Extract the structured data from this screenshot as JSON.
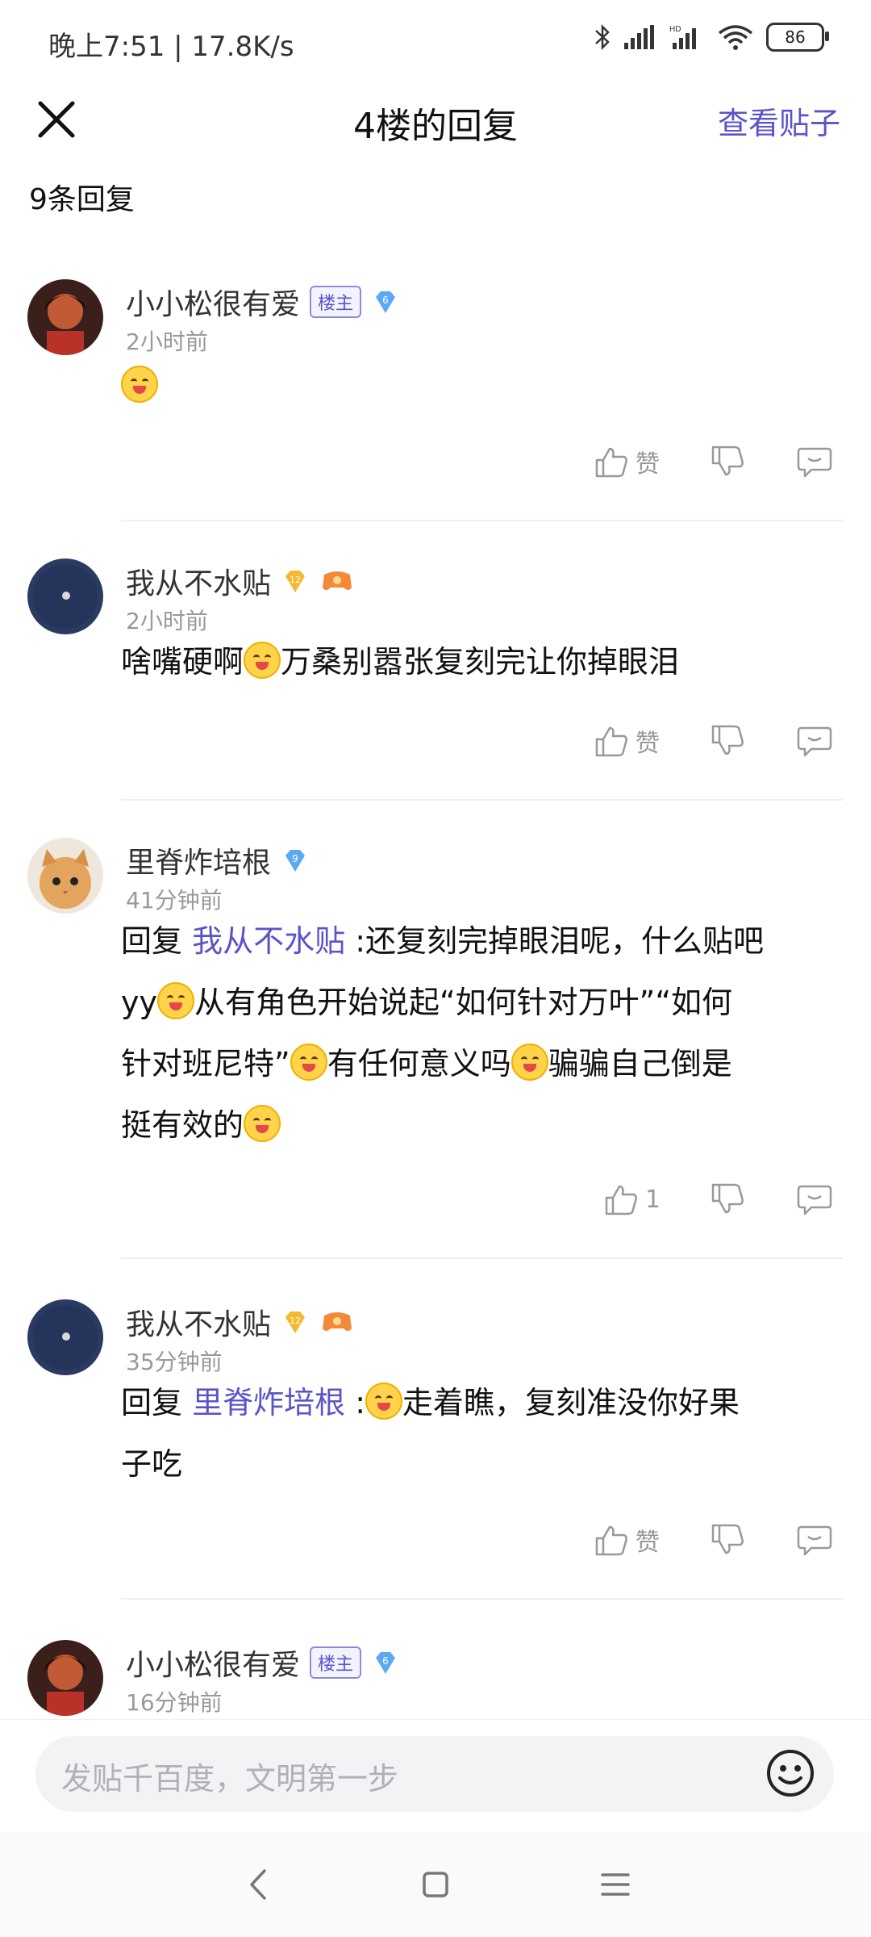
{
  "status": {
    "time": "晚上7:51 | 17.8K/s",
    "battery": "86",
    "network": "HD"
  },
  "header": {
    "title": "4楼的回复",
    "view_post": "查看贴子"
  },
  "count_label": "9条回复",
  "posts": [
    {
      "name": "小小松很有爱",
      "owner_badge": "楼主",
      "level": "6",
      "time": "2小时前",
      "likes": "赞"
    },
    {
      "name": "我从不水贴",
      "level": "12",
      "time": "2小时前",
      "content_a": "啥嘴硬啊",
      "content_b": "万桑别嚣张复刻完让你掉眼泪",
      "likes": "赞"
    },
    {
      "name": "里脊炸培根",
      "level": "9",
      "time": "41分钟前",
      "reply_word": "回复",
      "reply_to": "我从不水贴",
      "line1": ":还复刻完掉眼泪呢，什么贴吧",
      "line2a": "yy",
      "line2b": "从有角色开始说起“如何针对万叶”“如何",
      "line3a": "针对班尼特”",
      "line3b": "有任何意义吗",
      "line3c": "骗骗自己倒是",
      "line4": "挺有效的",
      "likes": "1"
    },
    {
      "name": "我从不水贴",
      "level": "12",
      "time": "35分钟前",
      "reply_word": "回复",
      "reply_to": "里脊炸培根",
      "line1a": ":",
      "line1b": "走着瞧，复刻准没你好果",
      "line2": "子吃",
      "likes": "赞"
    },
    {
      "name": "小小松很有爱",
      "owner_badge": "楼主",
      "level": "6",
      "time": "16分钟前"
    }
  ],
  "input": {
    "placeholder": "发贴千百度，文明第一步"
  },
  "colors": {
    "accent": "#5b54c8",
    "gem_blue": "#5ba8f5",
    "gem_gold": "#f5b82e"
  }
}
